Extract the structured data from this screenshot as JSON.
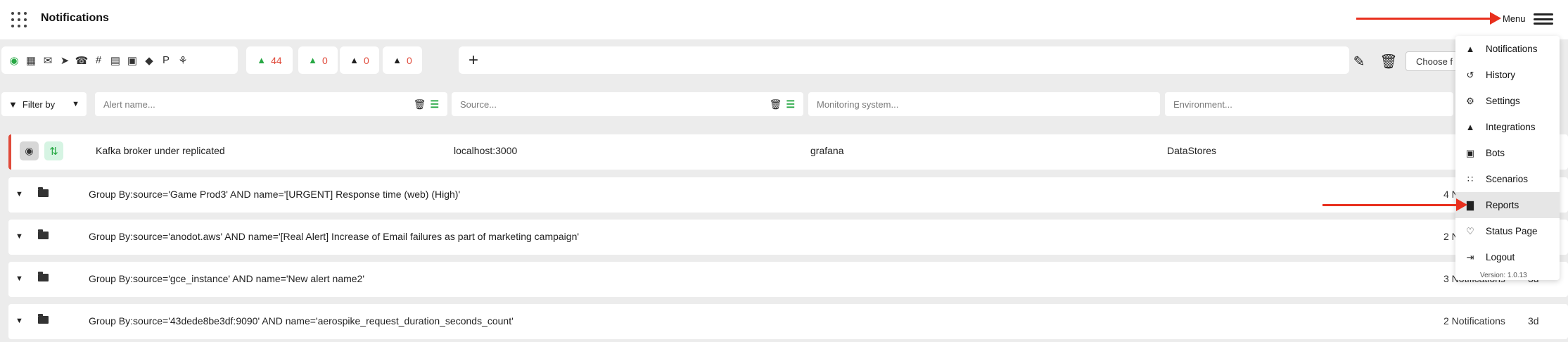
{
  "header": {
    "title": "Notifications",
    "menu_label": "Menu"
  },
  "toolbar": {
    "channel_icons": [
      "eye-icon",
      "teams-icon",
      "email-icon",
      "telegram-icon",
      "phone-icon",
      "slack-icon",
      "sms-icon",
      "discord-icon",
      "signl4-icon",
      "pushover-icon",
      "webhook-icon"
    ],
    "counters": [
      {
        "icon": "bell-alert-icon",
        "value": "44"
      },
      {
        "icon": "bell-ack-icon",
        "value": "0"
      },
      {
        "icon": "bell-snooze-icon",
        "value": "0"
      },
      {
        "icon": "bell-off-icon",
        "value": "0"
      }
    ],
    "add_label": "+",
    "choose_label": "Choose f"
  },
  "filters": {
    "filter_by_label": "Filter by",
    "alert_name_placeholder": "Alert name...",
    "source_placeholder": "Source...",
    "monitoring_placeholder": "Monitoring system...",
    "environment_placeholder": "Environment...",
    "edge_char": ")"
  },
  "alert": {
    "name": "Kafka broker under replicated",
    "source": "localhost:3000",
    "monitoring": "grafana",
    "environment": "DataStores"
  },
  "groups": [
    {
      "label": "Group By:source='Game Prod3' AND name='[URGENT] Response time (web) (High)'",
      "count": "4 N",
      "age": ""
    },
    {
      "label": "Group By:source='anodot.aws' AND name='[Real Alert] Increase of Email failures as part of marketing campaign'",
      "count": "2 N",
      "age": ""
    },
    {
      "label": "Group By:source='gce_instance' AND name='New alert name2'",
      "count": "3 Notifications",
      "age": "3d"
    },
    {
      "label": "Group By:source='43dede8be3df:9090' AND name='aerospike_request_duration_seconds_count'",
      "count": "2 Notifications",
      "age": "3d"
    }
  ],
  "menu": {
    "items": [
      {
        "label": "Notifications",
        "icon": "bell-icon"
      },
      {
        "label": "History",
        "icon": "history-icon"
      },
      {
        "label": "Settings",
        "icon": "gear-icon"
      },
      {
        "label": "Integrations",
        "icon": "bell-icon"
      },
      {
        "label": "Bots",
        "icon": "robot-icon"
      },
      {
        "label": "Scenarios",
        "icon": "scenarios-icon"
      },
      {
        "label": "Reports",
        "icon": "chart-icon"
      },
      {
        "label": "Status Page",
        "icon": "heartbeat-icon"
      },
      {
        "label": "Logout",
        "icon": "logout-icon"
      }
    ],
    "version": "Version: 1.0.13"
  },
  "colors": {
    "accent_green": "#27a844",
    "alert_red": "#e04a3a",
    "annotation_arrow": "#e8301e"
  }
}
